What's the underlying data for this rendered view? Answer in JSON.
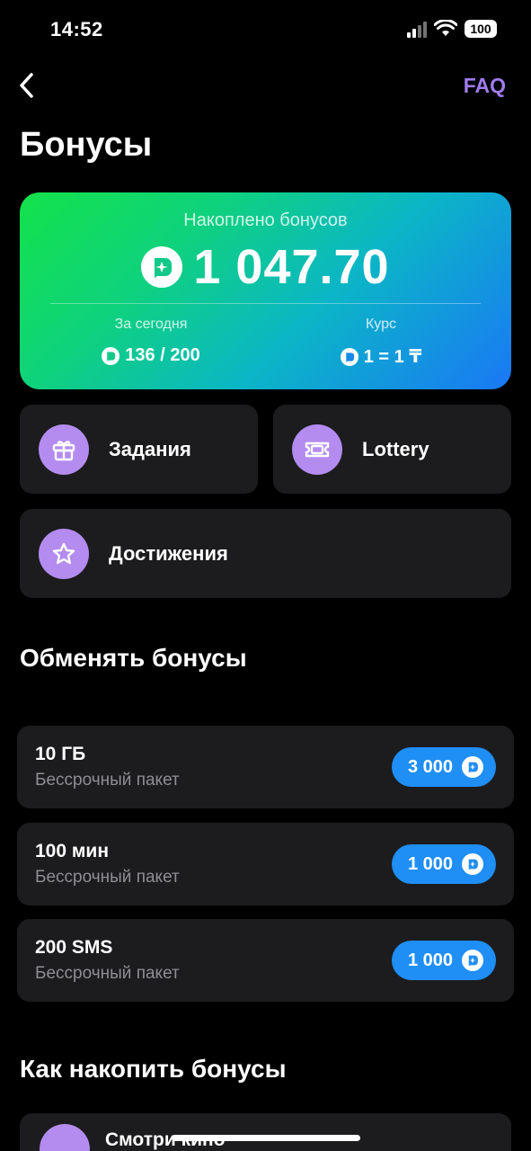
{
  "status_bar": {
    "time": "14:52",
    "battery": "100"
  },
  "header": {
    "back_icon": "chevron-left-icon",
    "faq_label": "FAQ",
    "title": "Бонусы"
  },
  "colors": {
    "accent_purple": "#a07cf0",
    "icon_bg_purple": "#b48cf0",
    "price_blue": "#1f8ef5",
    "card_bg": "#1c1c1e"
  },
  "balance": {
    "label": "Накоплено бонусов",
    "amount": "1 047.70",
    "today_label": "За сегодня",
    "today_value": "136 / 200",
    "rate_label": "Курс",
    "rate_value": "1 = 1 ₸"
  },
  "tiles": [
    {
      "label": "Задания",
      "icon": "gift-icon"
    },
    {
      "label": "Lottery",
      "icon": "ticket-icon"
    },
    {
      "label": "Достижения",
      "icon": "star-icon"
    }
  ],
  "exchange": {
    "title": "Обменять бонусы",
    "offers": [
      {
        "name": "10 ГБ",
        "subtitle": "Бессрочный пакет",
        "price": "3 000"
      },
      {
        "name": "100 мин",
        "subtitle": "Бессрочный пакет",
        "price": "1 000"
      },
      {
        "name": "200 SMS",
        "subtitle": "Бессрочный пакет",
        "price": "1 000"
      }
    ]
  },
  "earn": {
    "title": "Как накопить бонусы",
    "first_item": "Смотри кино"
  }
}
